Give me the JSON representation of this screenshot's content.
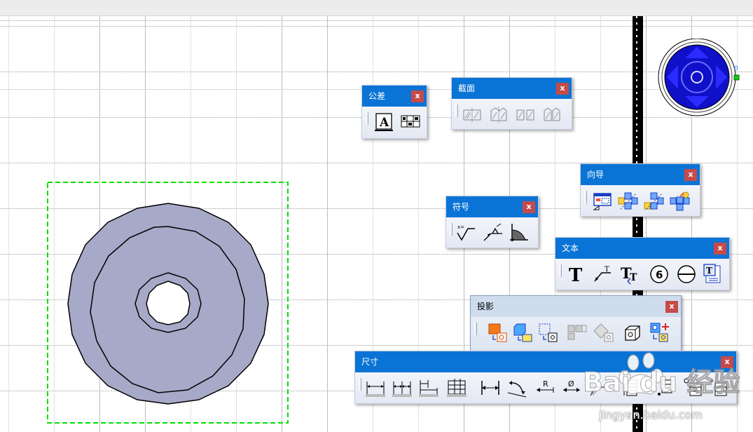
{
  "toolbars": {
    "tolerance": {
      "title": "公差",
      "close": "x",
      "icons": [
        "datum-letter-icon",
        "feature-control-frame-icon"
      ]
    },
    "section": {
      "title": "截面",
      "close": "x",
      "icons": [
        "section-view-icon",
        "section-cut-icon",
        "partial-section-icon",
        "offset-section-icon"
      ]
    },
    "wizard": {
      "title": "向导",
      "close": "x",
      "icons": [
        "sheet-wizard-icon",
        "view-wizard-icon",
        "dimension-wizard-icon",
        "annotation-wizard-icon"
      ]
    },
    "symbol": {
      "title": "符号",
      "close": "x",
      "icons": [
        "roughness-symbol-icon",
        "welding-symbol-icon",
        "taper-symbol-icon"
      ]
    },
    "text": {
      "title": "文本",
      "close": "x",
      "icons": [
        "text-icon",
        "leader-text-icon",
        "text-replace-icon",
        "balloon-icon",
        "datum-target-icon",
        "text-frame-icon"
      ]
    },
    "projection": {
      "title": "投影",
      "close": "x",
      "icons": [
        "front-view-icon",
        "projection-view-icon",
        "auxiliary-view-icon",
        "detail-view-icon",
        "clipping-view-icon",
        "isometric-view-icon",
        "advanced-view-icon"
      ]
    },
    "dimension": {
      "title": "尺寸",
      "close": "x",
      "icons": [
        "chain-dimension-icon",
        "cumulated-dimension-icon",
        "stacked-dimension-icon",
        "baseline-dimension-icon",
        "length-dimension-icon",
        "angle-dimension-icon",
        "radius-dimension-icon",
        "diameter-dimension-icon",
        "chamfer-dimension-icon",
        "thread-dimension-icon",
        "coordinate-dimension-icon",
        "hole-table-icon",
        "point-table-icon"
      ]
    }
  },
  "watermark": {
    "brand": "Bai du 经验",
    "url": "jingyan.baidu.com"
  },
  "colors": {
    "part_fill": "#a7a9c8",
    "selection_box": "#00e000",
    "title_bar": "#0a74d6",
    "close_button": "#c64a4a",
    "compass": "#1010c8"
  }
}
